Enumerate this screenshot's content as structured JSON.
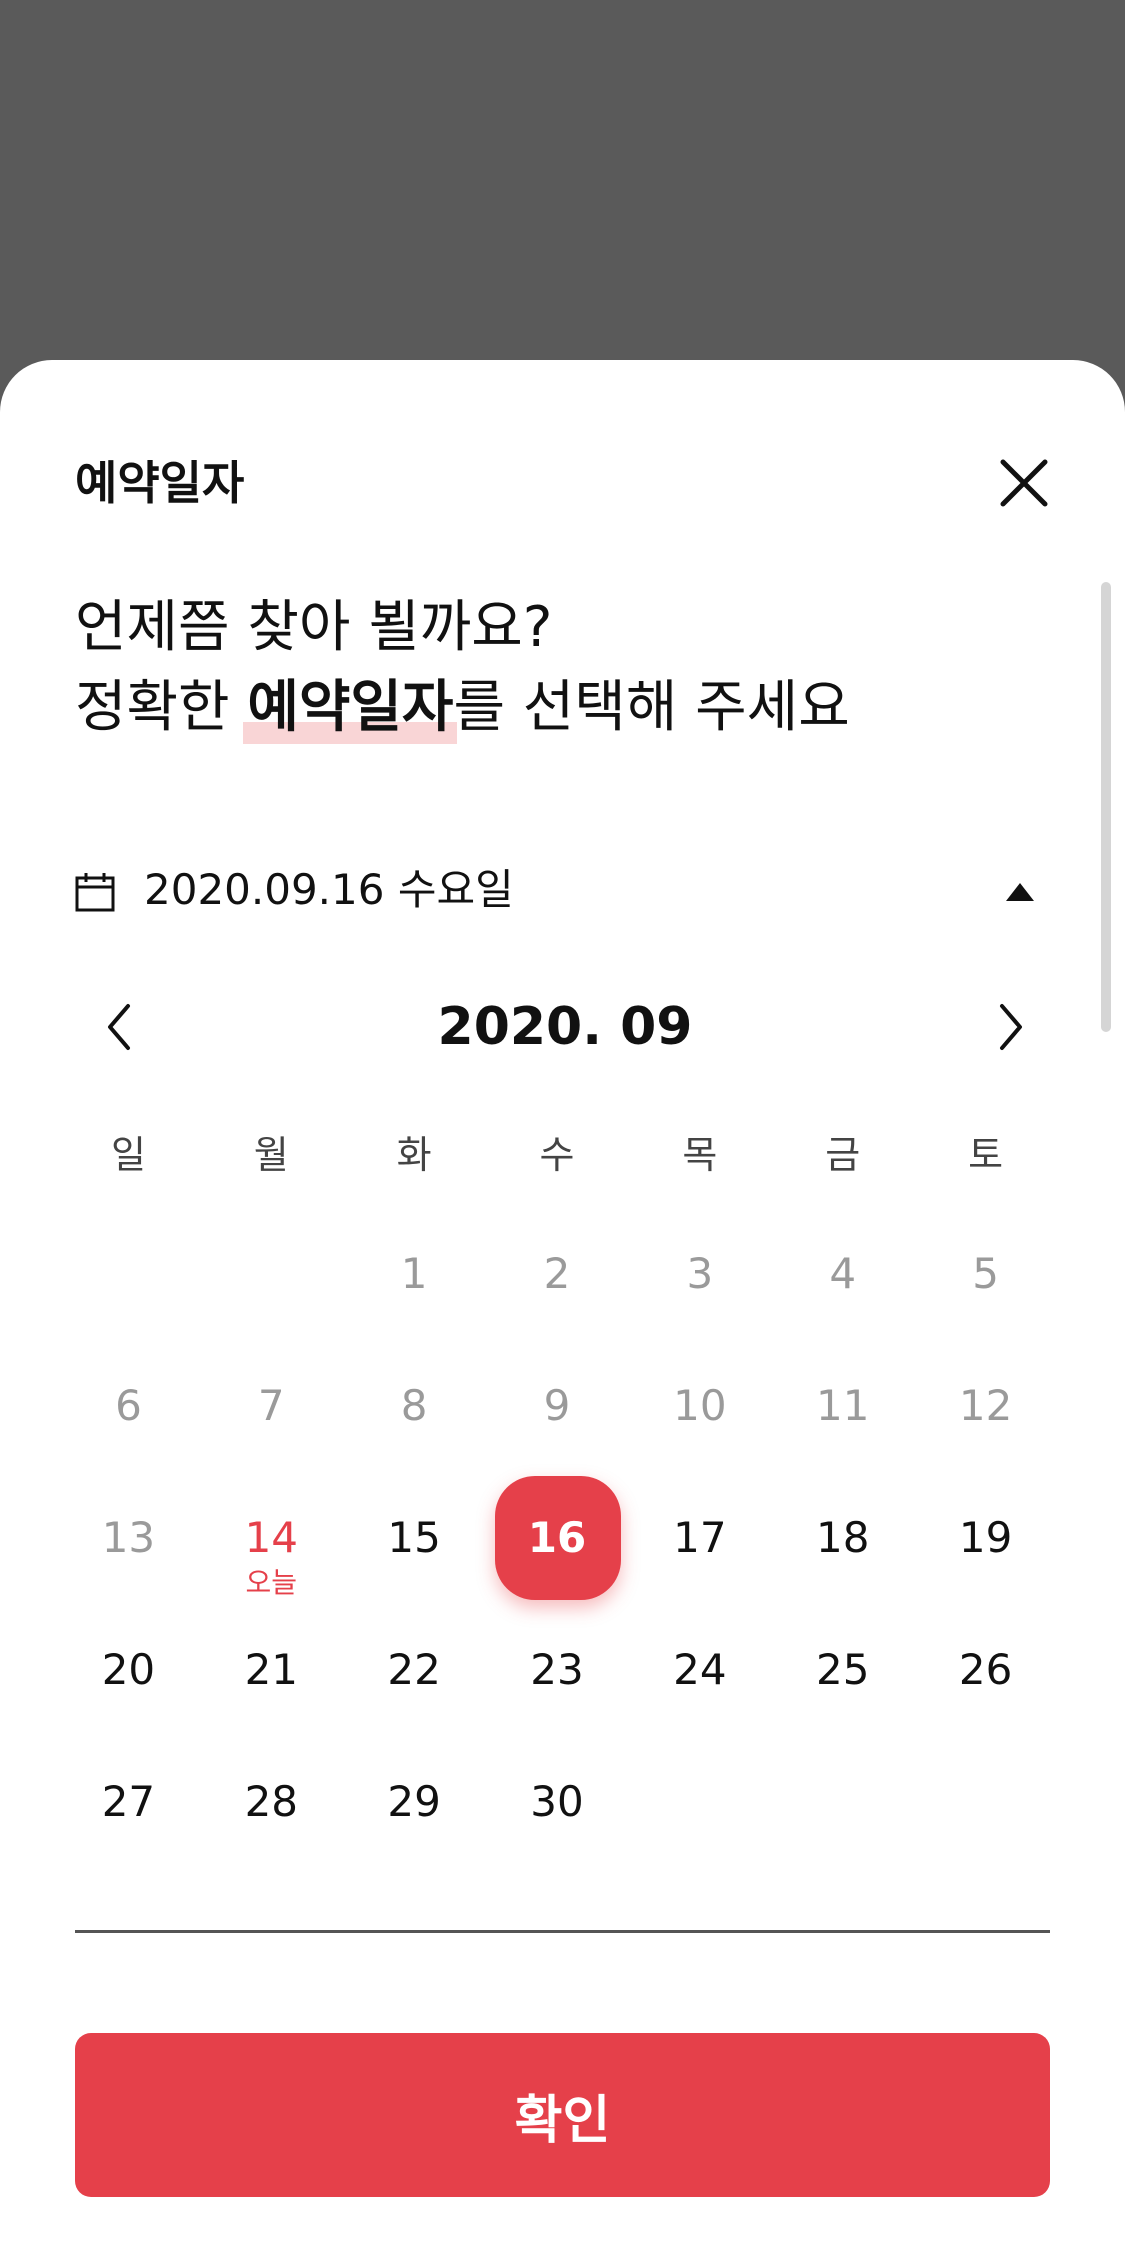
{
  "sheet": {
    "title": "예약일자",
    "close_icon": "close-icon"
  },
  "intro": {
    "line1": "언제쯤 찾아 뵐까요?",
    "line2_prefix": "정확한 ",
    "line2_highlight": "예약일자",
    "line2_suffix": "를 선택해 주세요"
  },
  "date_selector": {
    "icon": "calendar-icon",
    "value": "2020.09.16 수요일",
    "toggle_icon": "triangle-up-icon"
  },
  "calendar": {
    "month_label": "2020. 09",
    "prev_icon": "chevron-left-icon",
    "next_icon": "chevron-right-icon",
    "weekdays": [
      "일",
      "월",
      "화",
      "수",
      "목",
      "금",
      "토"
    ],
    "weeks": [
      [
        null,
        null,
        "1",
        "2",
        "3",
        "4",
        "5"
      ],
      [
        "6",
        "7",
        "8",
        "9",
        "10",
        "11",
        "12"
      ],
      [
        "13",
        "14",
        "15",
        "16",
        "17",
        "18",
        "19"
      ],
      [
        "20",
        "21",
        "22",
        "23",
        "24",
        "25",
        "26"
      ],
      [
        "27",
        "28",
        "29",
        "30",
        null,
        null,
        null
      ]
    ],
    "today_day": "14",
    "today_label": "오늘",
    "selected_day": "16",
    "accent_color": "#e5404a"
  },
  "footer": {
    "confirm_label": "확인"
  }
}
